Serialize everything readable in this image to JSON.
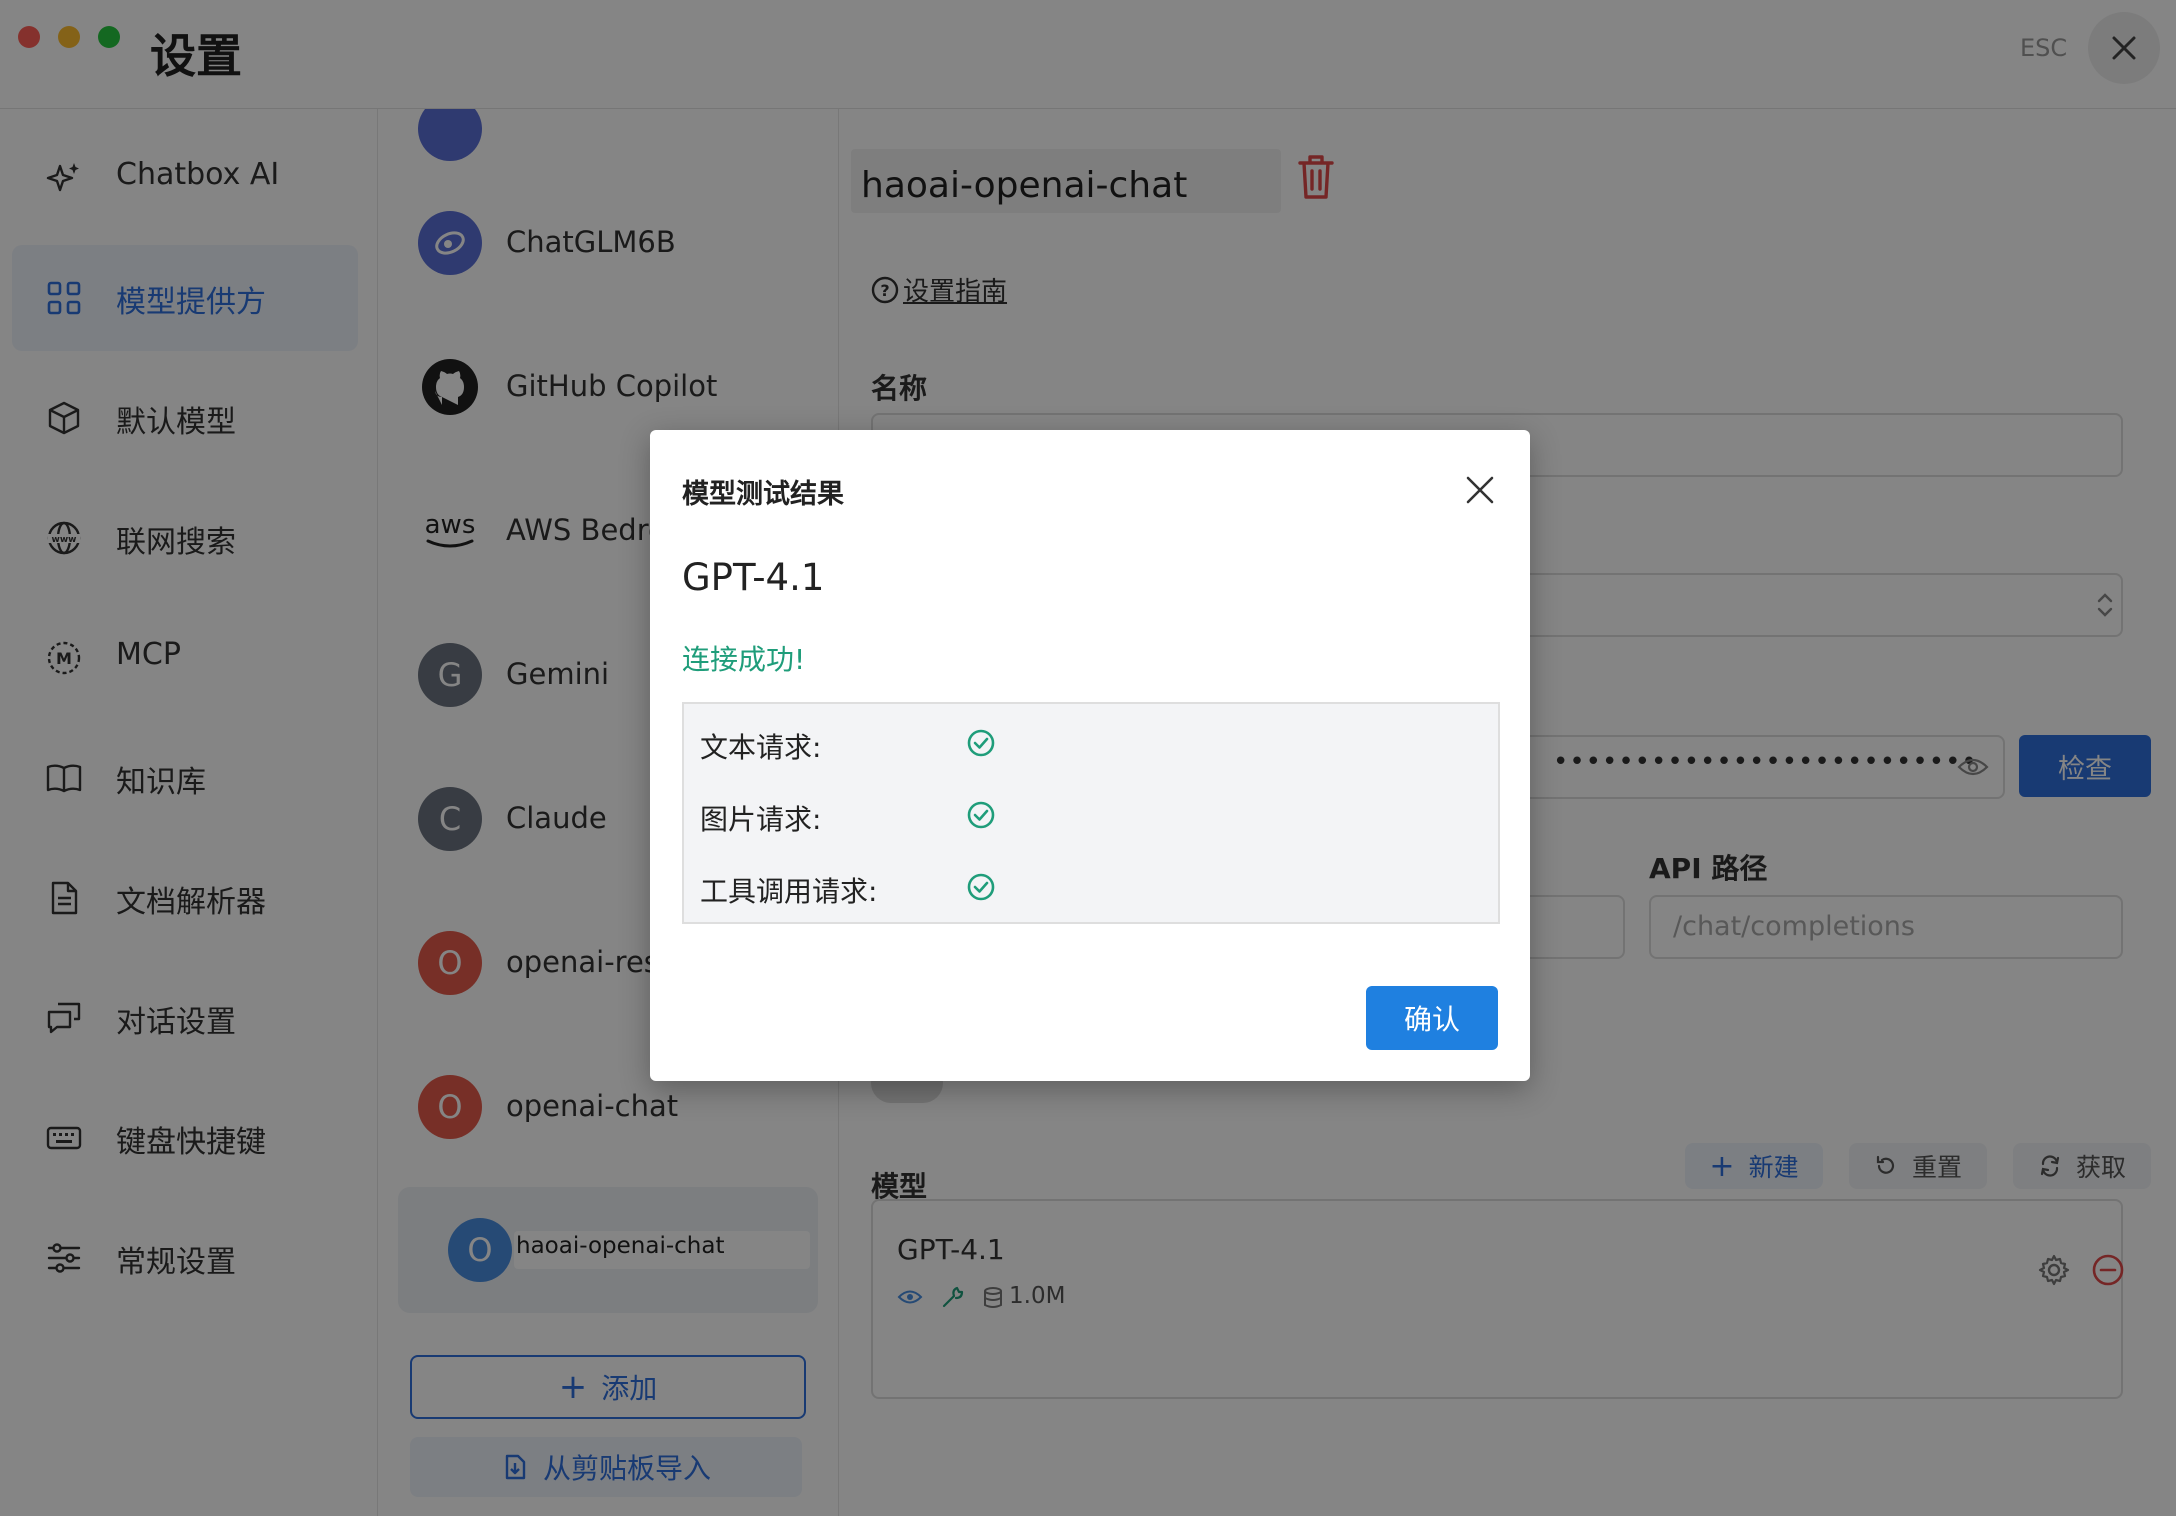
{
  "window": {
    "title": "设置",
    "esc_label": "ESC"
  },
  "sidebar": {
    "items": [
      {
        "label": "Chatbox AI",
        "icon": "sparkles-icon"
      },
      {
        "label": "模型提供方",
        "icon": "grid-icon",
        "active": true
      },
      {
        "label": "默认模型",
        "icon": "cube-icon"
      },
      {
        "label": "联网搜索",
        "icon": "globe-www-icon"
      },
      {
        "label": "MCP",
        "icon": "mcp-icon"
      },
      {
        "label": "知识库",
        "icon": "book-icon"
      },
      {
        "label": "文档解析器",
        "icon": "document-icon"
      },
      {
        "label": "对话设置",
        "icon": "chat-bubbles-icon"
      },
      {
        "label": "键盘快捷键",
        "icon": "keyboard-icon"
      },
      {
        "label": "常规设置",
        "icon": "sliders-icon"
      }
    ]
  },
  "providers": {
    "items": [
      {
        "name": "ChatGLM6B",
        "avatar": ""
      },
      {
        "name": "GitHub Copilot",
        "avatar": ""
      },
      {
        "name": "AWS Bedrock",
        "avatar": ""
      },
      {
        "name": "Gemini",
        "avatar": "G"
      },
      {
        "name": "Claude",
        "avatar": "C"
      },
      {
        "name": "openai-responses",
        "avatar": "O"
      },
      {
        "name": "openai-chat",
        "avatar": "O"
      },
      {
        "name": "haoai-openai-chat",
        "avatar": "O",
        "selected": true
      }
    ],
    "add_label": "添加",
    "import_label": "从剪贴板导入"
  },
  "main": {
    "provider_title": "haoai-openai-chat",
    "guide_link": "设置指南",
    "name_label": "名称",
    "check_button": "检查",
    "api_path_label": "API 路径",
    "api_path_placeholder": "/chat/completions",
    "api_key_masked": "••••••••••••••••••••••••••",
    "models_label": "模型",
    "new_button": "新建",
    "reset_button": "重置",
    "fetch_button": "获取",
    "model_card": {
      "name": "GPT-4.1",
      "context": "1.0M"
    }
  },
  "dialog": {
    "title": "模型测试结果",
    "model": "GPT-4.1",
    "status": "连接成功!",
    "results": [
      {
        "label": "文本请求:",
        "ok": true
      },
      {
        "label": "图片请求:",
        "ok": true
      },
      {
        "label": "工具调用请求:",
        "ok": true
      }
    ],
    "confirm": "确认"
  },
  "colors": {
    "accent": "#2f6fdc",
    "success": "#1f9d7a",
    "danger": "#e04a4a",
    "confirm": "#1f80e0"
  }
}
